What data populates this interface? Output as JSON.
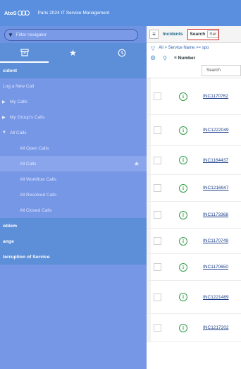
{
  "header": {
    "brand": "AtoS",
    "title": "Paris 2024 IT Service Management"
  },
  "sidebar": {
    "filter_placeholder": "Filter navigator",
    "tabs": [
      {
        "icon": "archive-icon"
      },
      {
        "icon": "star-icon"
      },
      {
        "icon": "clock-icon"
      }
    ],
    "items": [
      {
        "label": "cident",
        "type": "section"
      },
      {
        "label": "Log a New Call",
        "type": "item"
      },
      {
        "label": "My Calls",
        "type": "item",
        "arrow": "right"
      },
      {
        "label": "My Group's Calls",
        "type": "item",
        "arrow": "right"
      },
      {
        "label": "All Calls",
        "type": "item",
        "arrow": "down"
      },
      {
        "label": "All Open Calls",
        "type": "child"
      },
      {
        "label": "All Calls",
        "type": "child",
        "selected": true,
        "starred": true
      },
      {
        "label": "All Workflow Calls",
        "type": "child"
      },
      {
        "label": "All Resolved Calls",
        "type": "child"
      },
      {
        "label": "All Closed Calls",
        "type": "child"
      },
      {
        "label": "oblem",
        "type": "section"
      },
      {
        "label": "ange",
        "type": "section"
      },
      {
        "label": "terruption of Service",
        "type": "section"
      }
    ]
  },
  "list": {
    "menu_icon": "hamburger-icon",
    "title": "Incidents",
    "search_label": "Search",
    "search_field_value": "Ser",
    "breadcrumb": "All > Service Name >= spo",
    "column_header": "Number",
    "column_search_placeholder": "Search",
    "rows": [
      {
        "number": "INC1170762"
      },
      {
        "number": "INC1222049"
      },
      {
        "number": "INC1164437"
      },
      {
        "number": "INC1216947"
      },
      {
        "number": "INC1173368"
      },
      {
        "number": "INC1170749"
      },
      {
        "number": "INC1170650"
      },
      {
        "number": "INC1221489"
      },
      {
        "number": "INC1217202"
      }
    ]
  },
  "colors": {
    "banner": "#5a8fe0",
    "sidebar": "#7696e6",
    "section": "#5d8ed8",
    "search_highlight": "#d9302c",
    "info_icon": "#2e9b44",
    "link": "#1d3f8a"
  }
}
